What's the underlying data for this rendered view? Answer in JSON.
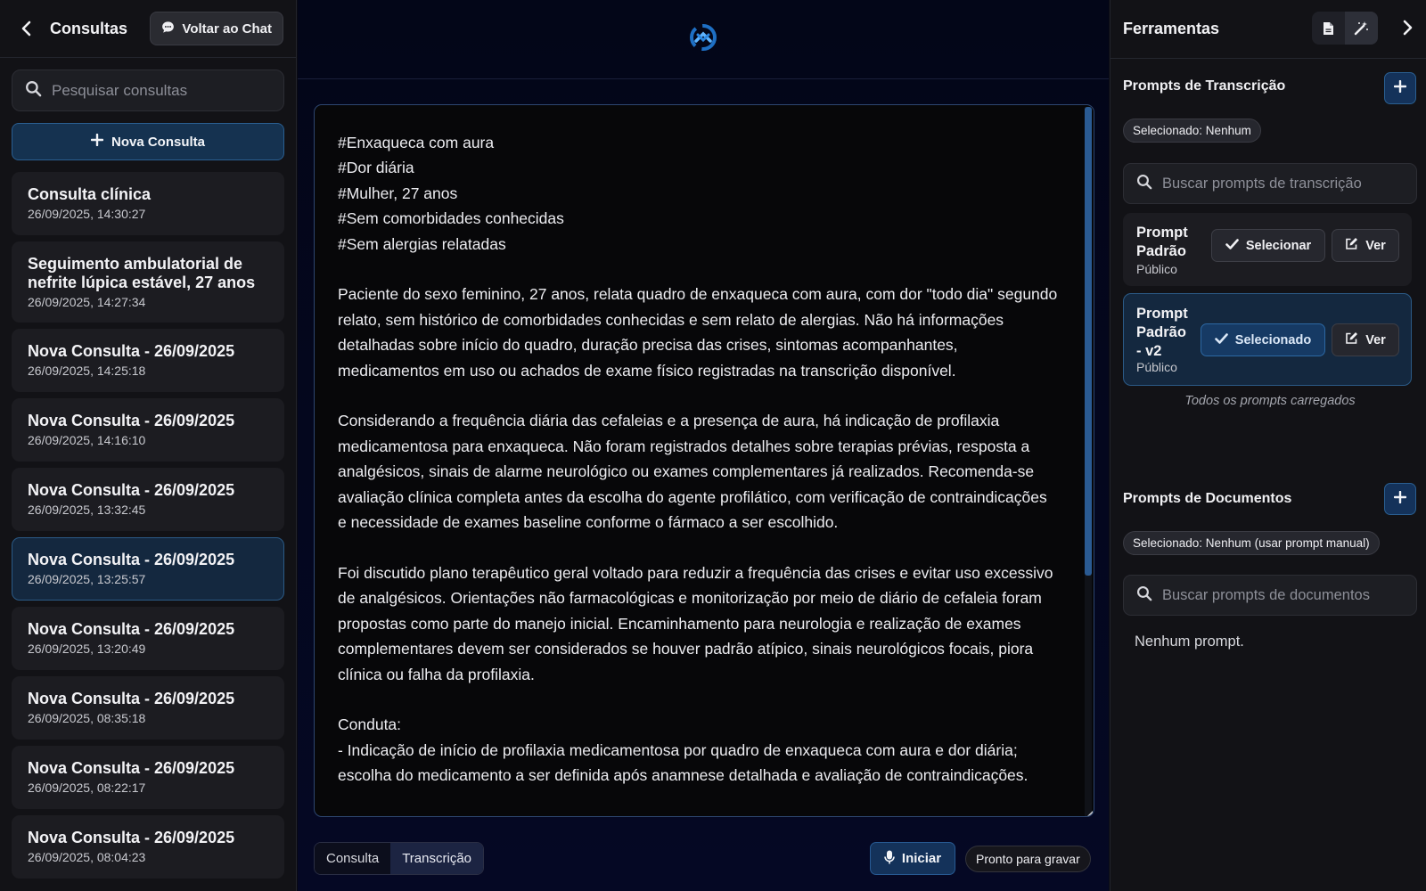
{
  "sidebar": {
    "title": "Consultas",
    "back_icon": "chevron-left-icon",
    "chat_button": "Voltar ao Chat",
    "search_placeholder": "Pesquisar consultas",
    "new_button": "Nova Consulta",
    "items": [
      {
        "title": "Consulta clínica",
        "date": "26/09/2025, 14:30:27",
        "active": false
      },
      {
        "title": "Seguimento ambulatorial de nefrite lúpica estável, 27 anos",
        "date": "26/09/2025, 14:27:34",
        "active": false
      },
      {
        "title": "Nova Consulta - 26/09/2025",
        "date": "26/09/2025, 14:25:18",
        "active": false
      },
      {
        "title": "Nova Consulta - 26/09/2025",
        "date": "26/09/2025, 14:16:10",
        "active": false
      },
      {
        "title": "Nova Consulta - 26/09/2025",
        "date": "26/09/2025, 13:32:45",
        "active": false
      },
      {
        "title": "Nova Consulta - 26/09/2025",
        "date": "26/09/2025, 13:25:57",
        "active": true
      },
      {
        "title": "Nova Consulta - 26/09/2025",
        "date": "26/09/2025, 13:20:49",
        "active": false
      },
      {
        "title": "Nova Consulta - 26/09/2025",
        "date": "26/09/2025, 08:35:18",
        "active": false
      },
      {
        "title": "Nova Consulta - 26/09/2025",
        "date": "26/09/2025, 08:22:17",
        "active": false
      },
      {
        "title": "Nova Consulta - 26/09/2025",
        "date": "26/09/2025, 08:04:23",
        "active": false
      }
    ]
  },
  "editor": {
    "text": "#Enxaqueca com aura\n#Dor diária\n#Mulher, 27 anos\n#Sem comorbidades conhecidas\n#Sem alergias relatadas\n\nPaciente do sexo feminino, 27 anos, relata quadro de enxaqueca com aura, com dor \"todo dia\" segundo relato, sem histórico de comorbidades conhecidas e sem relato de alergias. Não há informações detalhadas sobre início do quadro, duração precisa das crises, sintomas acompanhantes, medicamentos em uso ou achados de exame físico registradas na transcrição disponível.\n\nConsiderando a frequência diária das cefaleias e a presença de aura, há indicação de profilaxia medicamentosa para enxaqueca. Não foram registrados detalhes sobre terapias prévias, resposta a analgésicos, sinais de alarme neurológico ou exames complementares já realizados. Recomenda-se avaliação clínica completa antes da escolha do agente profilático, com verificação de contraindicações e necessidade de exames baseline conforme o fármaco a ser escolhido.\n\nFoi discutido plano terapêutico geral voltado para reduzir a frequência das crises e evitar uso excessivo de analgésicos. Orientações não farmacológicas e monitorização por meio de diário de cefaleia foram propostas como parte do manejo inicial. Encaminhamento para neurologia e realização de exames complementares devem ser considerados se houver padrão atípico, sinais neurológicos focais, piora clínica ou falha da profilaxia.\n\nConduta:\n- Indicação de início de profilaxia medicamentosa por quadro de enxaqueca com aura e dor diária; escolha do medicamento a ser definida após anamnese detalhada e avaliação de contraindicações."
  },
  "bottom": {
    "tabs": [
      {
        "label": "Consulta",
        "active": false
      },
      {
        "label": "Transcrição",
        "active": true
      }
    ],
    "start_button": "Iniciar",
    "status": "Pronto para gravar"
  },
  "tools": {
    "title": "Ferramentas",
    "transcription": {
      "title": "Prompts de Transcrição",
      "selected_badge": "Selecionado: Nenhum",
      "search_placeholder": "Buscar prompts de transcrição",
      "prompts": [
        {
          "name_lines": [
            "Prompt",
            "Padrão"
          ],
          "visibility": "Público",
          "select_label": "Selecionar",
          "view_label": "Ver",
          "selected": false
        },
        {
          "name_lines": [
            "Prompt",
            "Padrão",
            "- v2"
          ],
          "visibility": "Público",
          "select_label": "Selecionado",
          "view_label": "Ver",
          "selected": true
        }
      ],
      "loaded_note": "Todos os prompts carregados"
    },
    "documents": {
      "title": "Prompts de Documentos",
      "selected_badge": "Selecionado: Nenhum (usar prompt manual)",
      "search_placeholder": "Buscar prompts de documentos",
      "empty": "Nenhum prompt."
    }
  },
  "colors": {
    "accent": "#2a5f91",
    "active_bg": "#14283f",
    "bg": "#0a0a12"
  }
}
